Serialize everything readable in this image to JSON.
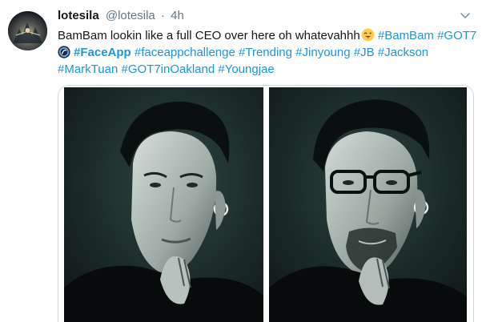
{
  "tweet": {
    "display_name": "lotesila",
    "handle": "@lotesila",
    "separator": "·",
    "time": "4h",
    "text_line1": "BamBam lookin like a full CEO over here oh whatevahhh",
    "line1_tags": [
      "#BamBam",
      "#GOT7"
    ],
    "line2_tags": [
      "#FaceApp",
      "#faceappchallenge",
      "#Trending",
      "#Jinyoung",
      "#JB",
      "#Jackson"
    ],
    "line3_tags": [
      "#MarkTuan",
      "#GOT7inOakland",
      "#Youngjae"
    ],
    "emoji": "winking-face-with-tongue",
    "icons": {
      "faceapp": "faceapp-logo-icon",
      "caret": "chevron-down-icon"
    }
  },
  "colors": {
    "link": "#1b95e0",
    "muted": "#657786",
    "text": "#14171a",
    "photo_bg": "#13201e"
  }
}
